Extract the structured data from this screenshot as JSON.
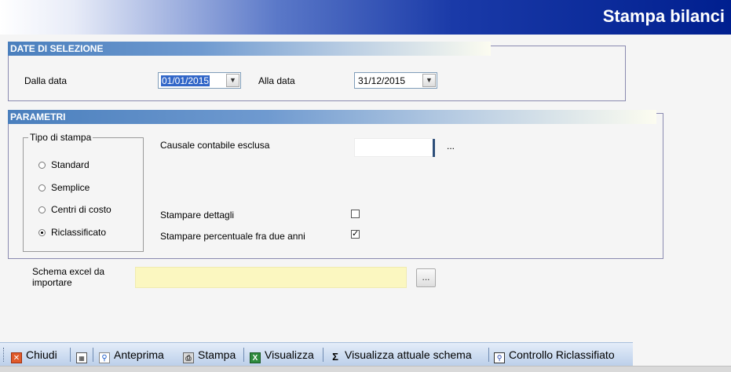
{
  "window": {
    "title": "Stampa bilanci"
  },
  "date_section": {
    "header": "DATE DI SELEZIONE",
    "from_label": "Dalla data",
    "from_value": "01/01/2015",
    "to_label": "Alla data",
    "to_value": "31/12/2015"
  },
  "params_section": {
    "header": "PARAMETRI",
    "tipo_legend": "Tipo di stampa",
    "options": [
      "Standard",
      "Semplice",
      "Centri di costo",
      "Riclassificato"
    ],
    "selected_option": "Riclassificato",
    "causale_label": "Causale contabile esclusa",
    "causale_value": "",
    "causale_browse": "...",
    "dettagli_label": "Stampare dettagli",
    "dettagli_checked": false,
    "percentuale_label": "Stampare percentuale fra due anni",
    "percentuale_checked": true
  },
  "schema": {
    "label_line1": "Schema excel da",
    "label_line2": "importare",
    "value": "",
    "browse": "..."
  },
  "toolbar": {
    "chiudi": "Chiudi",
    "anteprima": "Anteprima",
    "stampa": "Stampa",
    "visualizza": "Visualizza",
    "visualizza_schema": "Visualizza attuale schema",
    "controllo": "Controllo Riclassifiato"
  },
  "colors": {
    "title_gradient_end": "#001f8f",
    "header_gradient_start": "#4a7fbd",
    "schema_input_bg": "#fbf7c0",
    "selection": "#3166c8"
  },
  "icons": [
    "close-icon",
    "calculator-icon",
    "preview-icon",
    "printer-icon",
    "excel-icon",
    "sigma-icon",
    "view-scheme-icon"
  ]
}
